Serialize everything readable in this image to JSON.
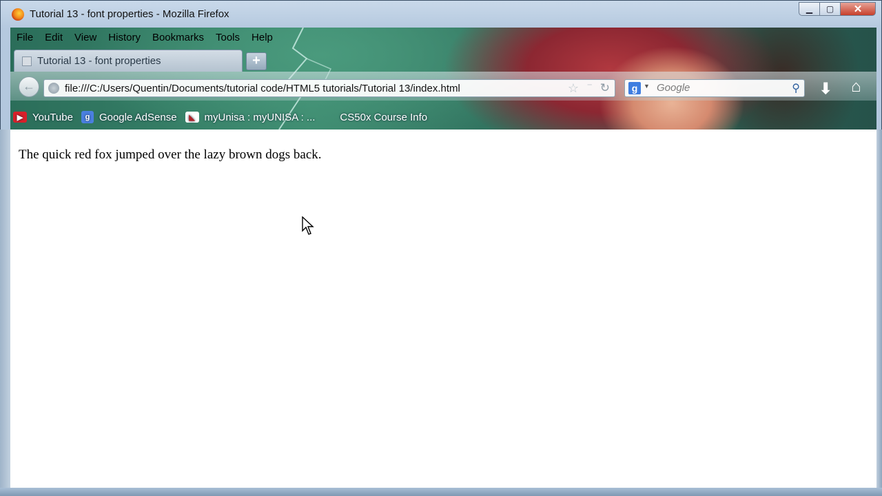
{
  "window": {
    "title": "Tutorial 13 - font properties - Mozilla Firefox",
    "controls": {
      "minimize": "▁",
      "maximize": "▢",
      "close": "✕"
    }
  },
  "menu": {
    "items": [
      "File",
      "Edit",
      "View",
      "History",
      "Bookmarks",
      "Tools",
      "Help"
    ]
  },
  "tabs": [
    {
      "label": "Tutorial 13 - font properties"
    }
  ],
  "newtab_label": "+",
  "nav": {
    "back_glyph": "←",
    "url": "file:///C:/Users/Quentin/Documents/tutorial code/HTML5 tutorials/Tutorial 13/index.html",
    "star_glyph": "☆",
    "drop_glyph": "⁻",
    "reload_glyph": "↻",
    "search_engine_glyph": "g",
    "search_drop_glyph": "▼",
    "search_placeholder": "Google",
    "magnifier_glyph": "⚲",
    "download_glyph": "⬇",
    "home_glyph": "⌂"
  },
  "bookmarks": [
    {
      "label": "YouTube",
      "icon": "youtube-icon",
      "glyph": "▶"
    },
    {
      "label": "Google AdSense",
      "icon": "google-icon",
      "glyph": "g"
    },
    {
      "label": "myUnisa : myUNISA : ...",
      "icon": "unisa-icon",
      "glyph": "◣"
    },
    {
      "label": "CS50x Course Info",
      "icon": "cs50-icon",
      "glyph": ""
    }
  ],
  "page": {
    "text": "The quick red fox jumped over the lazy brown dogs back."
  }
}
